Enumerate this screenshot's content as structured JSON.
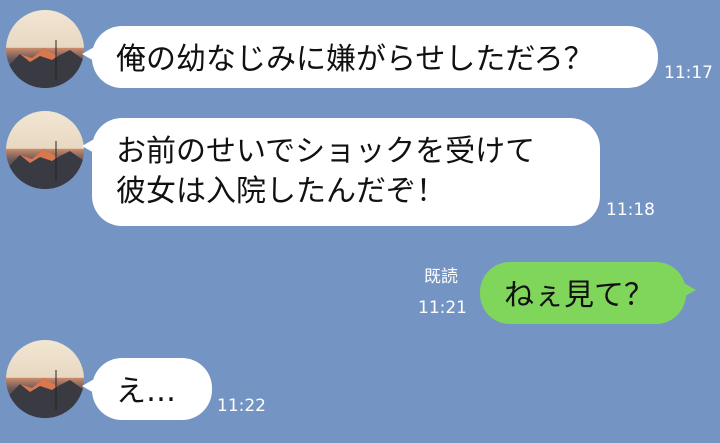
{
  "messages": [
    {
      "side": "left",
      "lines": [
        "俺の幼なじみに嫌がらせしただろ？"
      ],
      "time": "11:17"
    },
    {
      "side": "left",
      "lines": [
        "お前のせいでショックを受けて",
        "彼女は入院したんだぞ！"
      ],
      "time": "11:18"
    },
    {
      "side": "right",
      "lines": [
        "ねぇ見て？"
      ],
      "time": "11:21",
      "read": "既読"
    },
    {
      "side": "left",
      "lines": [
        "え…"
      ],
      "time": "11:22"
    }
  ],
  "colors": {
    "background": "#7494c4",
    "incoming_bubble": "#ffffff",
    "outgoing_bubble": "#7fd65a"
  }
}
